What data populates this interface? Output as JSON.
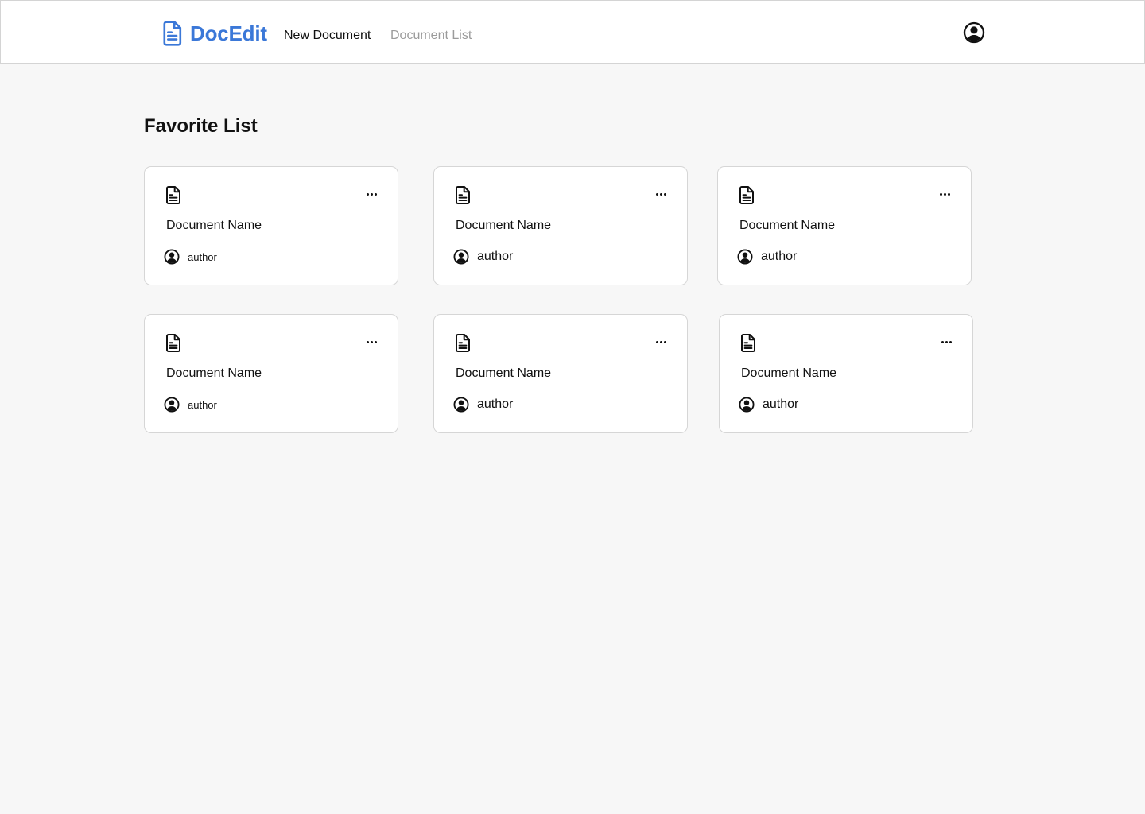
{
  "app": {
    "brand": "DocEdit",
    "brand_color": "#3b78d8",
    "brand_icon": "document-icon"
  },
  "nav": {
    "new_document": "New Document",
    "document_list": "Document List"
  },
  "header": {
    "profile_icon": "user-circle-icon"
  },
  "main": {
    "title": "Favorite List",
    "cards": [
      {
        "name": "Document Name",
        "author": "author"
      },
      {
        "name": "Document Name",
        "author": "author"
      },
      {
        "name": "Document Name",
        "author": "author"
      },
      {
        "name": "Document Name",
        "author": "author"
      },
      {
        "name": "Document Name",
        "author": "author"
      },
      {
        "name": "Document Name",
        "author": "author"
      }
    ],
    "card_icons": {
      "document": "document-icon",
      "more": "more-horizontal-icon",
      "author": "user-circle-icon"
    }
  }
}
